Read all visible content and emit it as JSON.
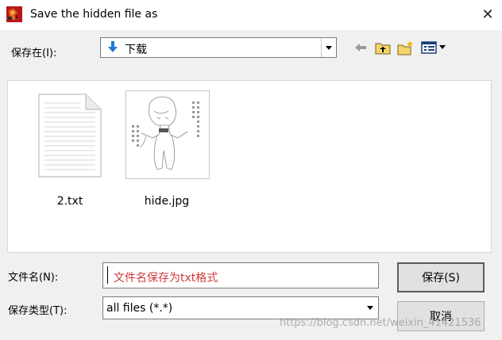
{
  "window": {
    "title": "Save the hidden file as",
    "close_glyph": "✕"
  },
  "toolbar": {
    "save_in_label": "保存在(I):",
    "location": "下载",
    "icons": [
      "back-arrow-icon",
      "up-folder-icon",
      "new-folder-icon",
      "view-menu-icon"
    ]
  },
  "files": [
    {
      "name": "2.txt",
      "type": "text-file-icon"
    },
    {
      "name": "hide.jpg",
      "type": "image-thumbnail"
    }
  ],
  "form": {
    "filename_label": "文件名(N):",
    "filename_value": "文件名保存为txt格式",
    "filetype_label": "保存类型(T):",
    "filetype_value": "all files (*.*)"
  },
  "buttons": {
    "save": "保存(S)",
    "cancel": "取消"
  },
  "watermark": "https://blog.csdn.net/weixin_41421536"
}
